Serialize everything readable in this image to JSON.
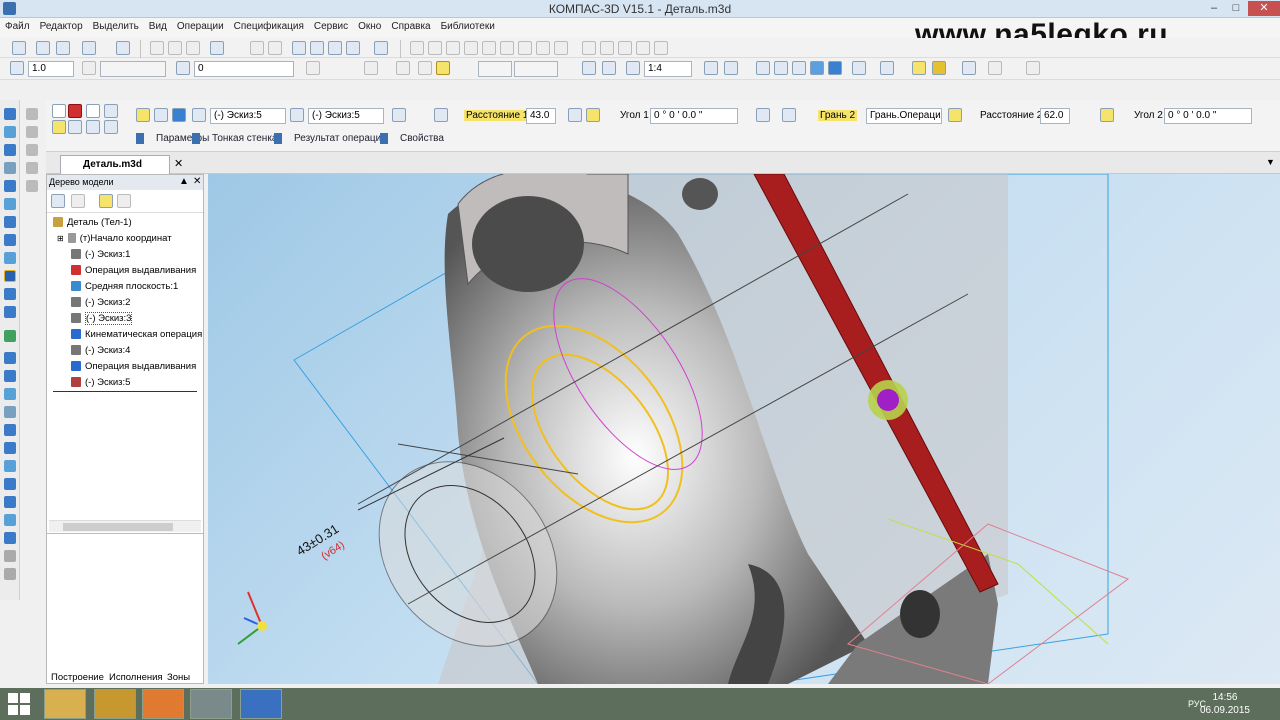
{
  "window": {
    "title": "КОМПАС-3D V15.1 - Деталь.m3d"
  },
  "watermark": "www.na5legko.ru",
  "menu": [
    "Файл",
    "Редактор",
    "Выделить",
    "Вид",
    "Операции",
    "Спецификация",
    "Сервис",
    "Окно",
    "Справка",
    "Библиотеки"
  ],
  "toolbar2": {
    "scale_value": "1.0",
    "layer_value": "0",
    "zoom_value": "1:4"
  },
  "params": {
    "sketch_a": "(-) Эскиз:5",
    "sketch_b": "(-) Эскиз:5",
    "distance1_label": "Расстояние 1",
    "distance1_value": "43.0",
    "angle1_label": "Угол 1",
    "angle1_value": "0 °    0 '    0.0 \"",
    "face2_label": "Грань 2",
    "face2_value": "Грань.Операция в",
    "distance2_label": "Расстояние 2",
    "distance2_value": "62.0",
    "angle2_label": "Угол 2",
    "angle2_value": "0 °    0 '    0.0 \"",
    "tabs": [
      "Параметры",
      "Тонкая стенка",
      "Результат операции",
      "Свойства"
    ]
  },
  "doc_tab": "Деталь.m3d",
  "tree": {
    "header": "Дерево модели",
    "items": [
      {
        "label": "Деталь (Тел-1)",
        "color": "#c8a040"
      },
      {
        "label": "(т)Начало координат",
        "color": "#7a7a7a"
      },
      {
        "label": "(-) Эскиз:1",
        "color": "#6a6a6a"
      },
      {
        "label": "Операция выдавливания",
        "color": "#d03030"
      },
      {
        "label": "Средняя плоскость:1",
        "color": "#3a8ad0"
      },
      {
        "label": "(-) Эскиз:2",
        "color": "#6a6a6a"
      },
      {
        "label": "(-) Эскиз:3",
        "color": "#6a6a6a"
      },
      {
        "label": "Кинематическая операция",
        "color": "#2a6ad0"
      },
      {
        "label": "(-) Эскиз:4",
        "color": "#6a6a6a"
      },
      {
        "label": "Операция выдавливания",
        "color": "#2a6ad0"
      },
      {
        "label": "(-) Эскиз:5",
        "color": "#b04040"
      }
    ],
    "bottom_tabs": [
      "Построение",
      "Исполнения",
      "Зоны"
    ]
  },
  "viewport": {
    "dimension_text": "43±0.31",
    "dimension_sub": "(v64)"
  },
  "taskbar": {
    "lang": "РУС",
    "time": "14:56",
    "date": "06.09.2015"
  }
}
